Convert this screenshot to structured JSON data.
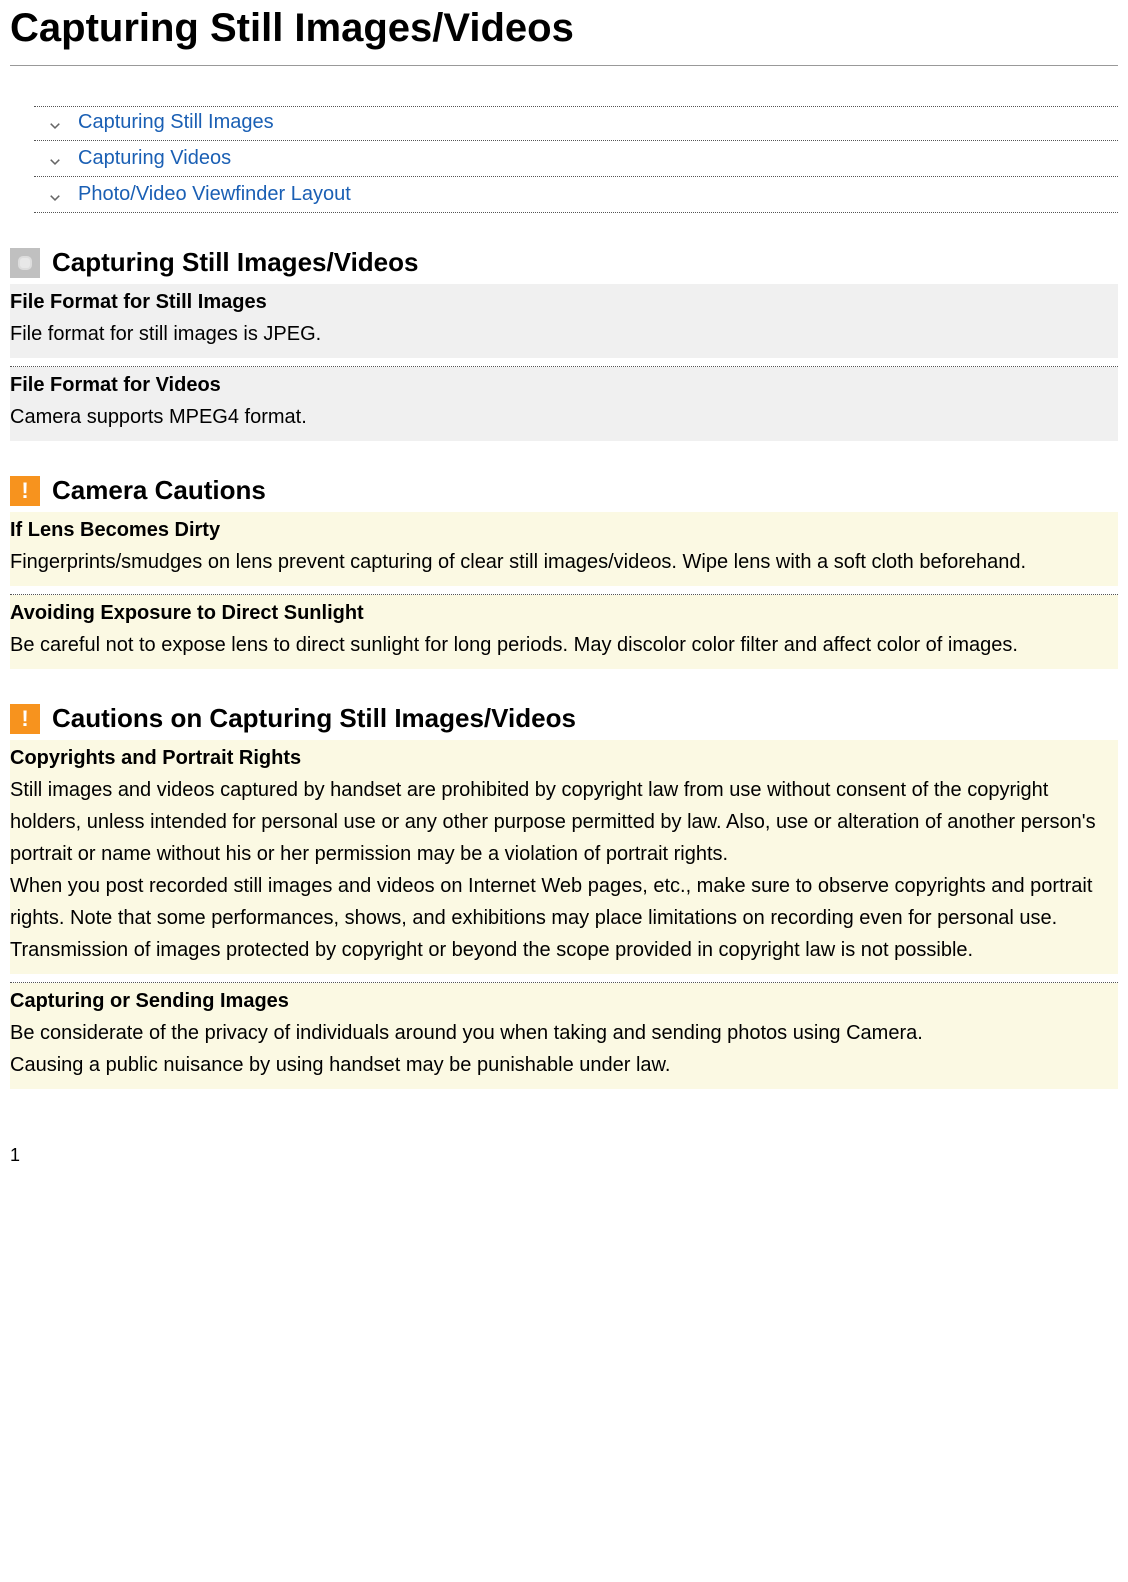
{
  "title": "Capturing Still Images/Videos",
  "toc": [
    {
      "label": "Capturing Still Images"
    },
    {
      "label": "Capturing Videos"
    },
    {
      "label": "Photo/Video Viewfinder Layout"
    }
  ],
  "sections": {
    "info": {
      "title": "Capturing Still Images/Videos",
      "items": [
        {
          "title": "File Format for Still Images",
          "body": "File format for still images is JPEG."
        },
        {
          "title": "File Format for Videos",
          "body": "Camera supports MPEG4 format."
        }
      ]
    },
    "cautions": {
      "title": "Camera Cautions",
      "items": [
        {
          "title": "If Lens Becomes Dirty",
          "body": "Fingerprints/smudges on lens prevent capturing of clear still images/videos. Wipe lens with a soft cloth beforehand."
        },
        {
          "title": "Avoiding Exposure to Direct Sunlight",
          "body": "Be careful not to expose lens to direct sunlight for long periods. May discolor color filter and affect color of images."
        }
      ]
    },
    "cautions2": {
      "title": "Cautions on Capturing Still Images/Videos",
      "items": [
        {
          "title": "Copyrights and Portrait Rights",
          "body1": "Still images and videos captured by handset are prohibited by copyright law from use without consent of the copyright holders, unless intended for personal use or any other purpose permitted by law. Also, use or alteration of another person's portrait or name without his or her permission may be a violation of portrait rights.",
          "body2": "When you post recorded still images and videos on Internet Web pages, etc., make sure to observe copyrights and portrait rights. Note that some performances, shows, and exhibitions may place limitations on recording even for personal use. Transmission of images protected by copyright or beyond the scope provided in copyright law is not possible."
        },
        {
          "title": "Capturing or Sending Images",
          "body1": "Be considerate of the privacy of individuals around you when taking and sending photos using Camera.",
          "body2": "Causing a public nuisance by using handset may be punishable under law."
        }
      ]
    }
  },
  "page_number": "1"
}
